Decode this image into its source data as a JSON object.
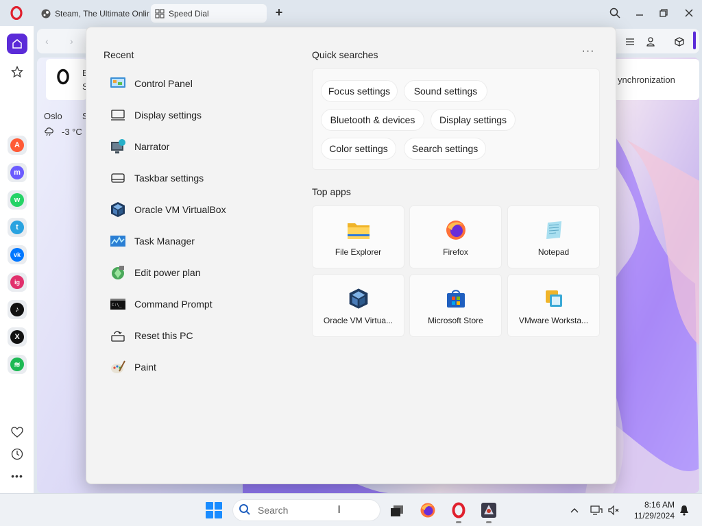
{
  "browser": {
    "tabs": [
      {
        "label": "Steam, The Ultimate Onlin",
        "active": false
      },
      {
        "label": "Speed Dial",
        "active": true
      }
    ],
    "new_tab_label": "+",
    "weather": {
      "city": "Oslo",
      "city_next": "S",
      "temp": "-3 °C"
    },
    "opera_card_letter": "E",
    "opera_card_sub": "S",
    "sync_label": "ynchronization",
    "accent_color": "#5b2bd8"
  },
  "sidebar": {
    "apps": [
      {
        "name": "aria",
        "color": "#ff5a36",
        "glyph": "A"
      },
      {
        "name": "messenger",
        "color": "#6b5bff",
        "glyph": "m"
      },
      {
        "name": "whatsapp",
        "color": "#25d366",
        "glyph": "w"
      },
      {
        "name": "telegram",
        "color": "#2aa3e0",
        "glyph": "t"
      },
      {
        "name": "vk",
        "color": "#0077ff",
        "glyph": "vk"
      },
      {
        "name": "instagram",
        "color": "#e1306c",
        "glyph": "ig"
      },
      {
        "name": "tiktok",
        "color": "#111111",
        "glyph": "♪"
      },
      {
        "name": "x",
        "color": "#111111",
        "glyph": "X"
      },
      {
        "name": "spotify",
        "color": "#1db954",
        "glyph": "≋"
      }
    ]
  },
  "panel": {
    "recent_title": "Recent",
    "recent": [
      {
        "label": "Control Panel",
        "icon": "control-panel-icon"
      },
      {
        "label": "Display settings",
        "icon": "display-icon"
      },
      {
        "label": "Narrator",
        "icon": "narrator-icon"
      },
      {
        "label": "Taskbar settings",
        "icon": "taskbar-icon"
      },
      {
        "label": "Oracle VM VirtualBox",
        "icon": "virtualbox-icon"
      },
      {
        "label": "Task Manager",
        "icon": "task-manager-icon"
      },
      {
        "label": "Edit power plan",
        "icon": "power-plan-icon"
      },
      {
        "label": "Command Prompt",
        "icon": "cmd-icon"
      },
      {
        "label": "Reset this PC",
        "icon": "reset-icon"
      },
      {
        "label": "Paint",
        "icon": "paint-icon"
      }
    ],
    "quick_title": "Quick searches",
    "more_label": "···",
    "quick": [
      "Focus settings",
      "Sound settings",
      "Bluetooth & devices",
      "Display settings",
      "Color settings",
      "Search settings"
    ],
    "top_apps_title": "Top apps",
    "top_apps": [
      {
        "label": "File Explorer",
        "icon": "file-explorer-icon"
      },
      {
        "label": "Firefox",
        "icon": "firefox-icon"
      },
      {
        "label": "Notepad",
        "icon": "notepad-icon"
      },
      {
        "label": "Oracle VM Virtua...",
        "icon": "virtualbox-icon"
      },
      {
        "label": "Microsoft Store",
        "icon": "store-icon"
      },
      {
        "label": "VMware Worksta...",
        "icon": "vmware-icon"
      }
    ]
  },
  "taskbar": {
    "search_placeholder": "Search",
    "time": "8:16 AM",
    "date": "11/29/2024"
  }
}
